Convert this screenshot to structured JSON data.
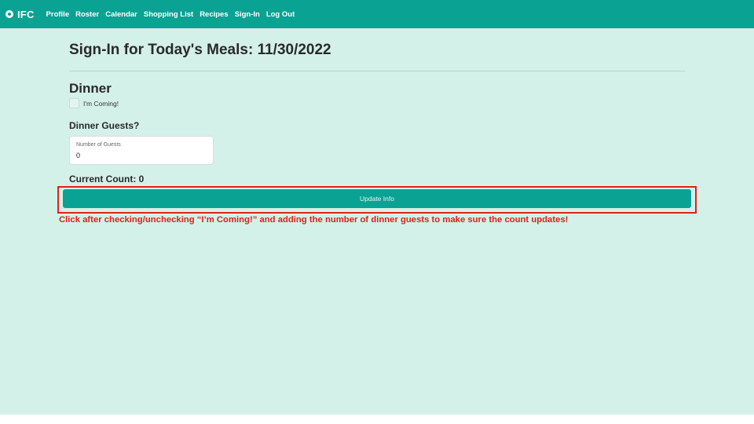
{
  "navbar": {
    "brand": "IFC",
    "brand_icon": "logo-icon",
    "links": [
      "Profile",
      "Roster",
      "Calendar",
      "Shopping List",
      "Recipes",
      "Sign-In",
      "Log Out"
    ]
  },
  "page": {
    "title": "Sign-In for Today's Meals: 11/30/2022"
  },
  "meal": {
    "heading": "Dinner",
    "coming_label": "I'm Coming!",
    "coming_checked": false,
    "guests_heading": "Dinner Guests?",
    "guests_field_label": "Number of Guests",
    "guests_value": "0",
    "count_text": "Current Count: 0",
    "update_button": "Update Info"
  },
  "annotation": {
    "text": "Click after checking/unchecking “I’m Coming!” and adding the number of dinner guests to make sure the count updates!"
  },
  "colors": {
    "primary": "#0aa293",
    "background": "#d3f1e9",
    "annotation_red": "#e0211a"
  }
}
